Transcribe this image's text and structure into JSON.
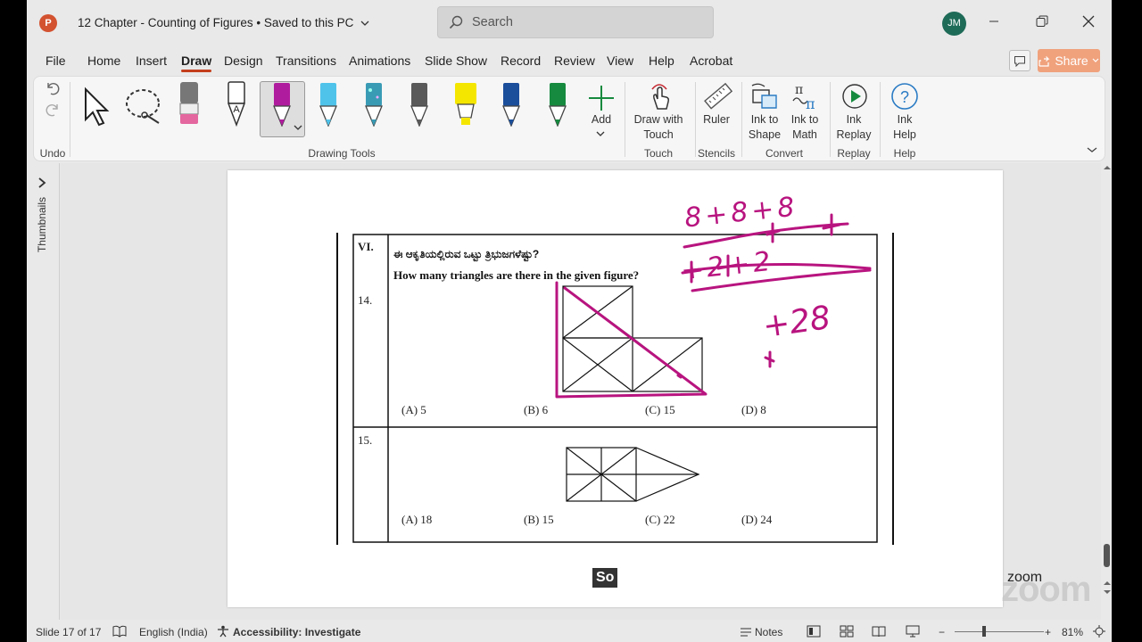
{
  "titlebar": {
    "app_logo": "P",
    "document_title": "12 Chapter - Counting of Figures • Saved to this PC",
    "search_placeholder": "Search",
    "user_initials": "JM"
  },
  "tabs": [
    "File",
    "Home",
    "Insert",
    "Draw",
    "Design",
    "Transitions",
    "Animations",
    "Slide Show",
    "Record",
    "Review",
    "View",
    "Help",
    "Acrobat"
  ],
  "active_tab": "Draw",
  "share_label": "Share",
  "ribbon": {
    "undo_group": "Undo",
    "drawing_tools_group": "Drawing Tools",
    "add_label": "Add",
    "draw_with_touch": [
      "Draw with",
      "Touch"
    ],
    "touch_group": "Touch",
    "ruler": "Ruler",
    "stencils_group": "Stencils",
    "ink_to_shape": [
      "Ink to",
      "Shape"
    ],
    "ink_to_math": [
      "Ink to",
      "Math"
    ],
    "convert_group": "Convert",
    "ink_replay": [
      "Ink",
      "Replay"
    ],
    "replay_group": "Replay",
    "ink_help": [
      "Ink",
      "Help"
    ],
    "help_group": "Help",
    "pen_colors": [
      "#b01c9e",
      "#4fc3ea",
      "#3a9bb5",
      "#5a5a5a",
      "#f5e600",
      "#1b4e9b",
      "#168a3e"
    ]
  },
  "thumbnails_label": "Thumbnails",
  "slide": {
    "section": "VI.",
    "q14_number": "14.",
    "q14_kannada": "ಈ ಆಕೃತಿಯಲ್ಲಿರುವ ಒಟ್ಟು ತ್ರಿಭುಜಗಳೆಷ್ಟು?",
    "q14_english": "How many triangles are there in the given figure?",
    "q14_options": [
      "(A)  5",
      "(B)  6",
      "(C)  15",
      "(D)  8"
    ],
    "q15_number": "15.",
    "q15_options": [
      "(A)  18",
      "(B)  15",
      "(C)  22",
      "(D)  24"
    ],
    "caption": "So",
    "watermark": "zoom",
    "ink_color": "#b8147f",
    "ink_text": [
      "8+8+8",
      "+2+2",
      "+28"
    ]
  },
  "status": {
    "slide_counter": "Slide 17 of 17",
    "language": "English (India)",
    "accessibility": "Accessibility: Investigate",
    "notes": "Notes",
    "zoom_level": "81%"
  }
}
